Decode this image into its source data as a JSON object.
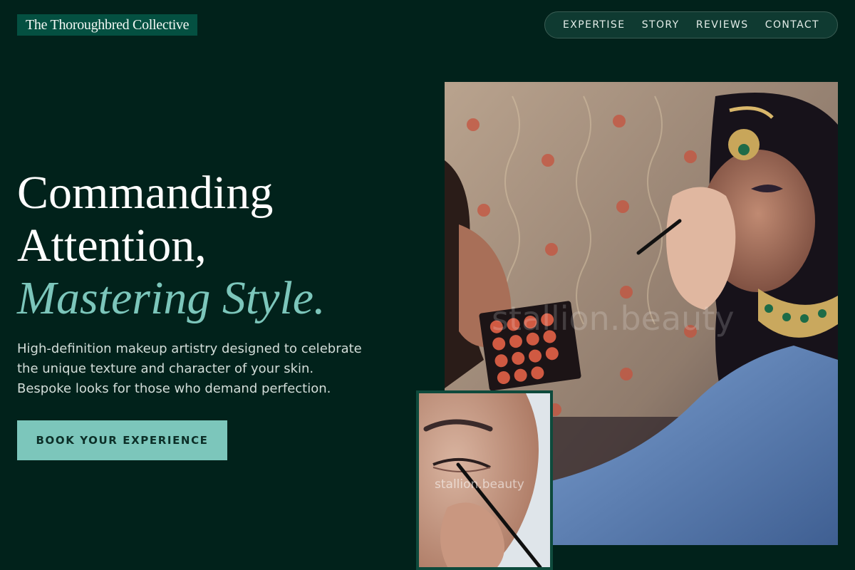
{
  "brand": {
    "name": "The Thoroughbred Collective"
  },
  "nav": {
    "items": [
      {
        "label": "EXPERTISE"
      },
      {
        "label": "STORY"
      },
      {
        "label": "REVIEWS"
      },
      {
        "label": "CONTACT"
      }
    ]
  },
  "hero": {
    "headline_line1": "Commanding",
    "headline_line2": "Attention,",
    "headline_accent": "Mastering Style.",
    "subcopy_lines": [
      "High-definition makeup artistry designed to celebrate",
      "the unique texture and character of your skin.",
      "Bespoke looks for those who demand perfection."
    ],
    "cta_label": "BOOK YOUR EXPERIENCE"
  },
  "media": {
    "main_watermark": "stallion.beauty",
    "inset_watermark": "stallion.beauty"
  },
  "colors": {
    "background": "#01221b",
    "brand_box": "#045041",
    "accent": "#7cc6bb",
    "nav_pill": "#0f3a31"
  }
}
